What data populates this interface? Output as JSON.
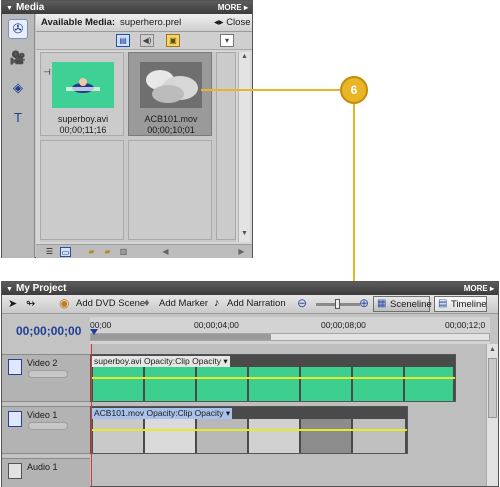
{
  "media_panel": {
    "title": "Media",
    "more_label": "MORE",
    "available_label": "Available Media:",
    "available_value": "superhero.prel",
    "close_label": "Close",
    "items": [
      {
        "name": "superboy.avi",
        "duration": "00;00;11;16"
      },
      {
        "name": "ACB101.mov",
        "duration": "00;00;10;01"
      }
    ]
  },
  "callout": {
    "number": "6"
  },
  "project_panel": {
    "title": "My Project",
    "more_label": "MORE",
    "toolbar": {
      "add_dvd_scene": "Add DVD Scene",
      "add_marker": "Add Marker",
      "add_narration": "Add Narration",
      "sceneline": "Sceneline",
      "timeline": "Timeline"
    },
    "timecode": "00;00;00;00",
    "ruler_ticks": [
      "00;00",
      "00;00;04;00",
      "00;00;08;00",
      "00;00;12;0"
    ],
    "tracks": [
      {
        "name": "Video 2",
        "clip": "superboy.avi",
        "effect": "Opacity:Clip Opacity"
      },
      {
        "name": "Video 1",
        "clip": "ACB101.mov",
        "effect": "Opacity:Clip Opacity"
      },
      {
        "name": "Audio 1"
      }
    ]
  },
  "colors": {
    "callout": "#e9b426",
    "accent_blue": "#1f3f96",
    "thumb_green": "#2ec98a"
  }
}
